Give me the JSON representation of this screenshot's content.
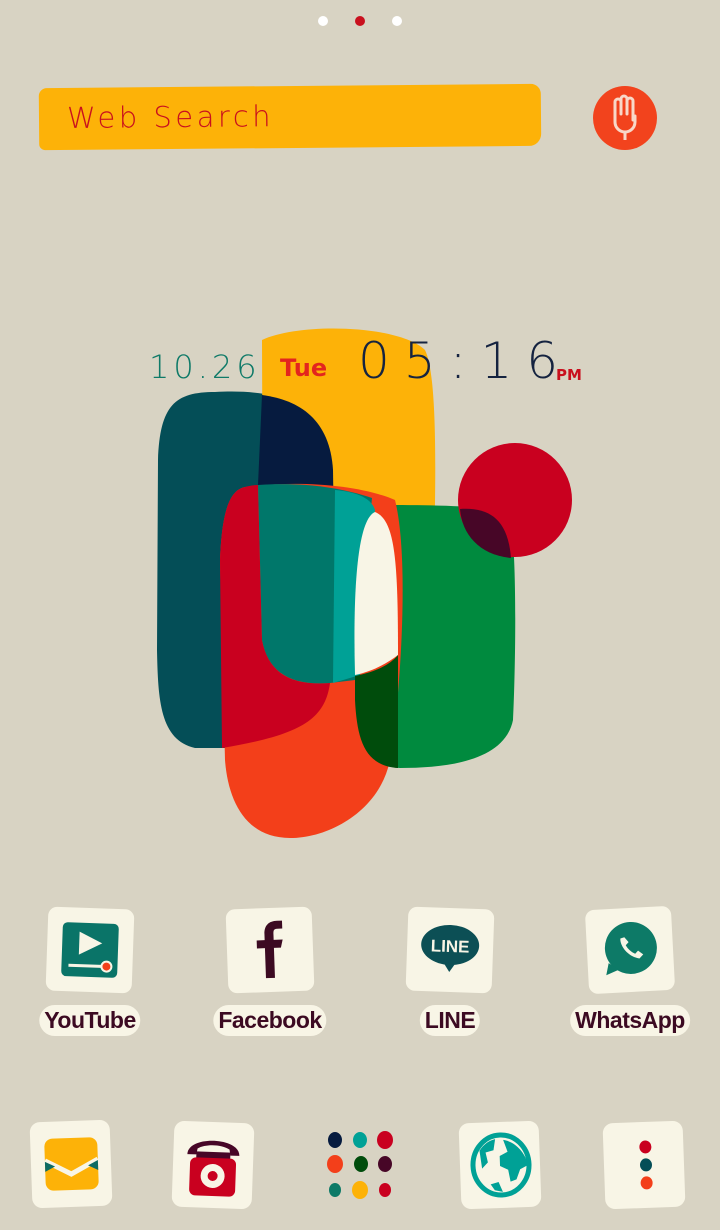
{
  "page_indicator": {
    "pages": 3,
    "active_index": 1,
    "colors": {
      "inactive": "#ffffff",
      "active": "#c9101e"
    }
  },
  "search": {
    "label": "Web Search",
    "icon": "voice-search-hand-mic-icon"
  },
  "clock": {
    "date": "10.26",
    "day": "Tue",
    "time": "05:16",
    "ampm": "PM"
  },
  "wallpaper": {
    "description": "overlapping translucent abstract rounded shapes",
    "colors": [
      "#044e57",
      "#fdb208",
      "#c9001f",
      "#f33f1a",
      "#008a3e",
      "#00a196",
      "#f8f5e6",
      "#061b3f"
    ]
  },
  "apps": [
    {
      "label": "YouTube",
      "icon": "video-play-icon"
    },
    {
      "label": "Facebook",
      "icon": "facebook-f-icon"
    },
    {
      "label": "LINE",
      "icon": "line-bubble-icon"
    },
    {
      "label": "WhatsApp",
      "icon": "whatsapp-phone-icon"
    }
  ],
  "dock": [
    {
      "name": "messages",
      "icon": "envelope-icon"
    },
    {
      "name": "phone",
      "icon": "rotary-phone-icon"
    },
    {
      "name": "app-drawer",
      "icon": "app-grid-dots-icon"
    },
    {
      "name": "browser",
      "icon": "globe-icon"
    },
    {
      "name": "menu",
      "icon": "more-vertical-dots-icon"
    }
  ]
}
